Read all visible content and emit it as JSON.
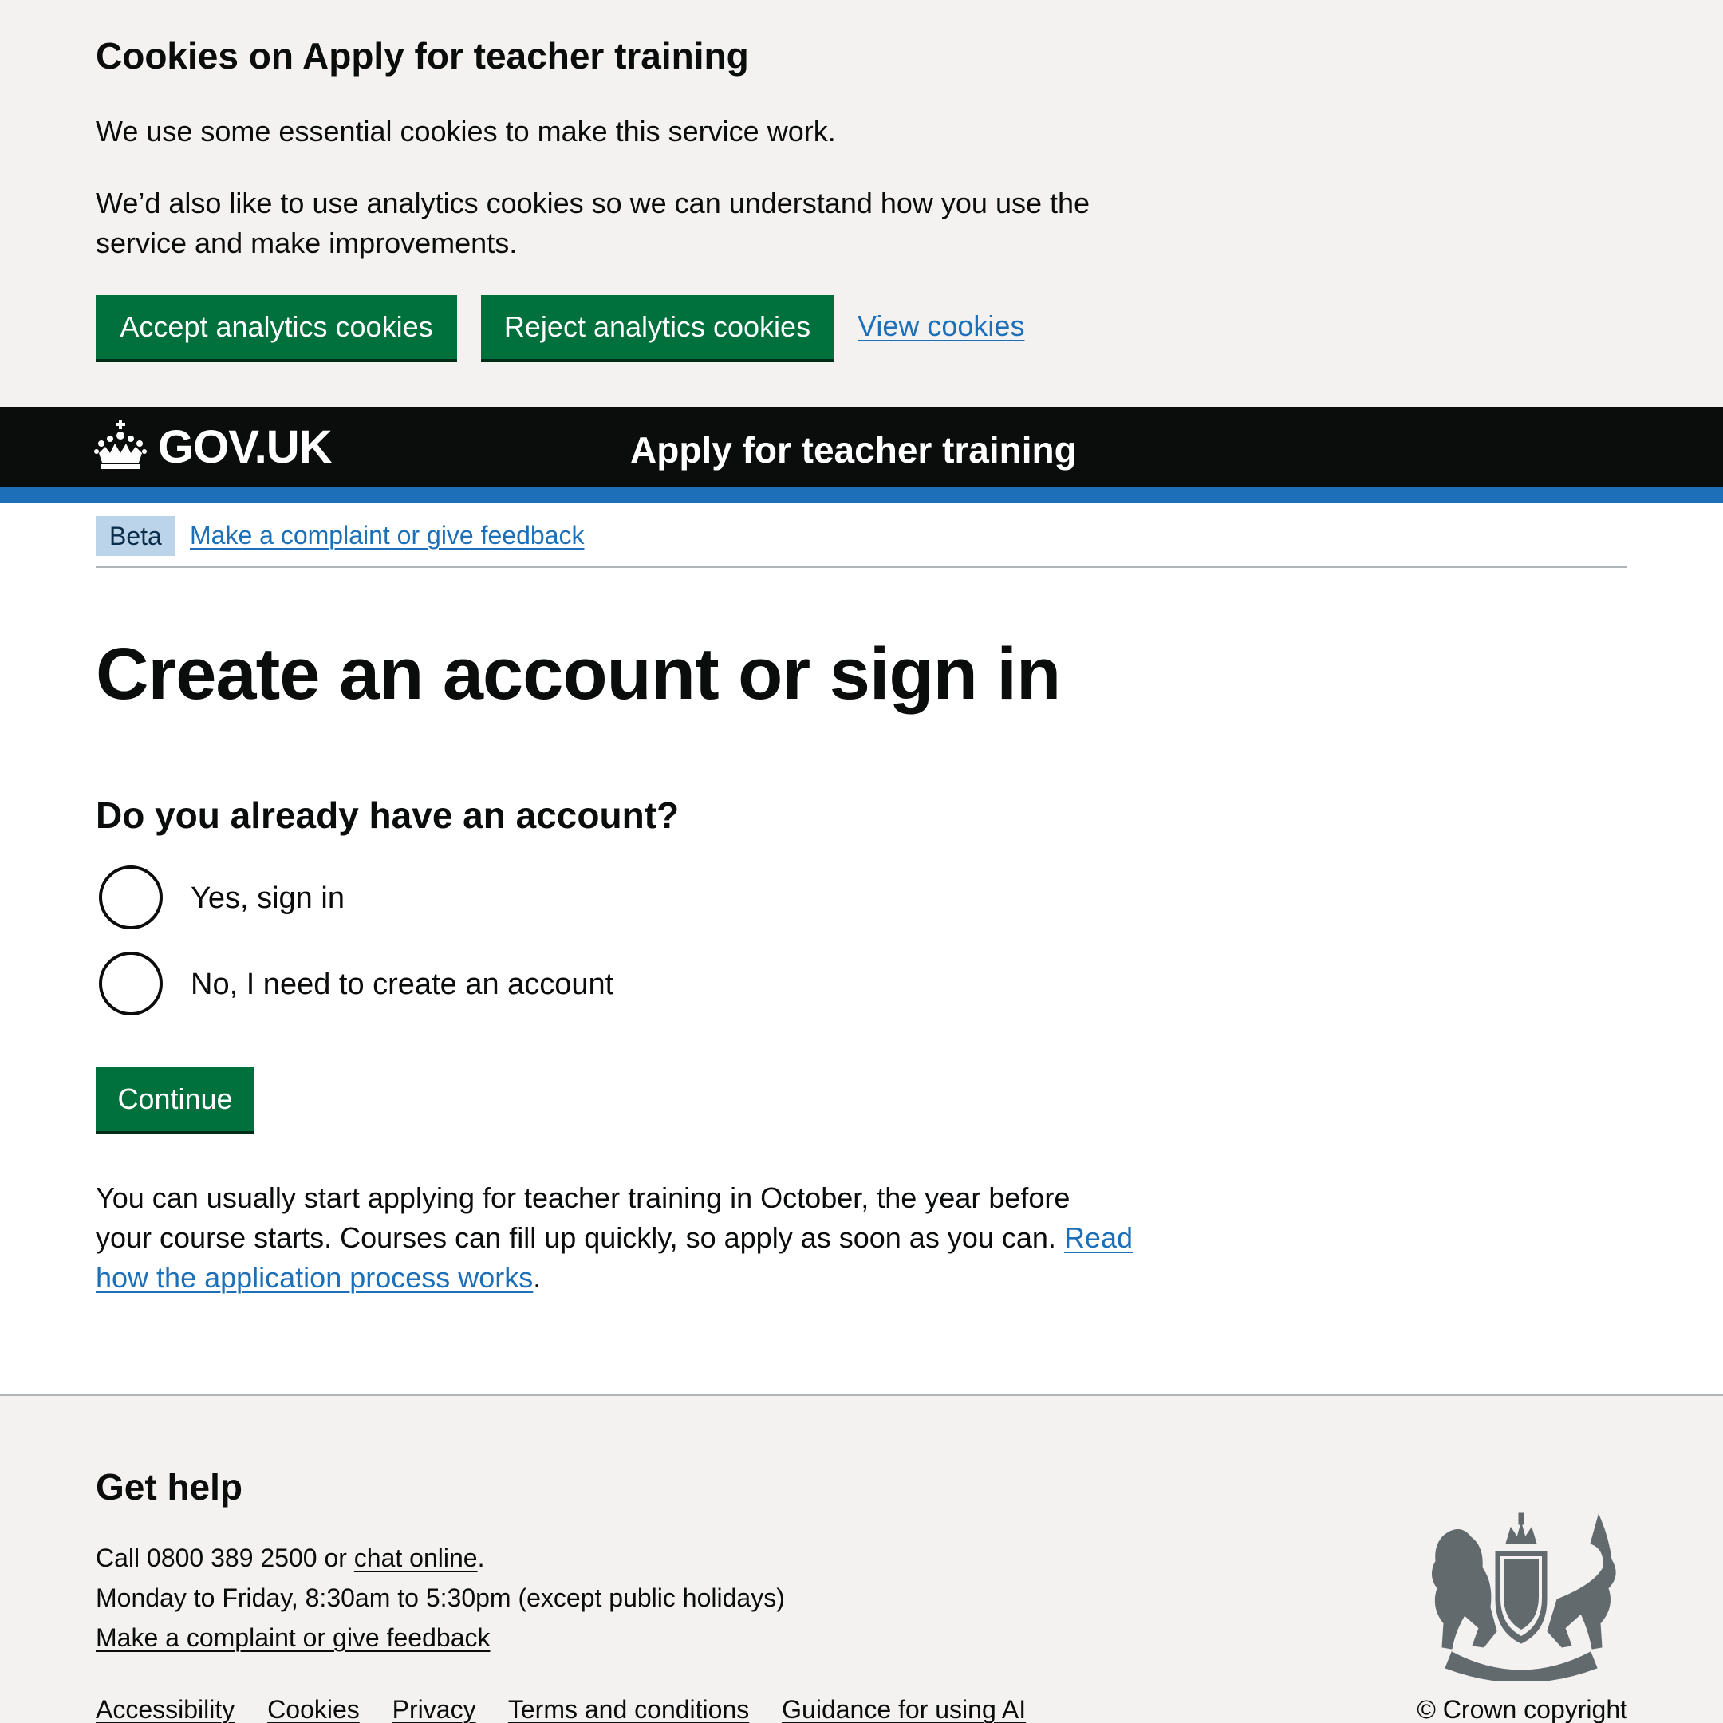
{
  "cookie_banner": {
    "title": "Cookies on Apply for teacher training",
    "paragraph_1": "We use some essential cookies to make this service work.",
    "paragraph_2": "We’d also like to use analytics cookies so we can understand how you use the service and make improvements.",
    "accept_label": "Accept analytics cookies",
    "reject_label": "Reject analytics cookies",
    "view_label": "View cookies"
  },
  "header": {
    "logo_text": "GOV.UK",
    "logo_icon": "crown-icon",
    "service_name": "Apply for teacher training"
  },
  "phase_banner": {
    "tag": "Beta",
    "link": "Make a complaint or give feedback"
  },
  "main": {
    "title": "Create an account or sign in",
    "question": "Do you already have an account?",
    "options": [
      {
        "label": "Yes, sign in",
        "selected": false
      },
      {
        "label": "No, I need to create an account",
        "selected": false
      }
    ],
    "continue_label": "Continue",
    "info_text": "You can usually start applying for teacher training in October, the year before your course starts. Courses can fill up quickly, so apply as soon as you can.",
    "info_link": "Read how the application process works",
    "info_suffix": "."
  },
  "footer": {
    "help_title": "Get help",
    "call_prefix": "Call 0800 389 2500 or ",
    "chat_link": "chat online",
    "call_suffix": ".",
    "hours": "Monday to Friday, 8:30am to 5:30pm (except public holidays)",
    "complaint_link": "Make a complaint or give feedback",
    "links": [
      "Accessibility",
      "Cookies",
      "Privacy",
      "Terms and conditions",
      "Guidance for using AI"
    ],
    "crest_icon": "royal-coat-of-arms-icon",
    "copyright": "© Crown copyright"
  },
  "colors": {
    "button_green": "#00703c",
    "link_blue": "#1d70b8",
    "header_black": "#0b0c0c",
    "banner_grey": "#f3f2f1",
    "beta_tag_bg": "#bbd4ea"
  }
}
